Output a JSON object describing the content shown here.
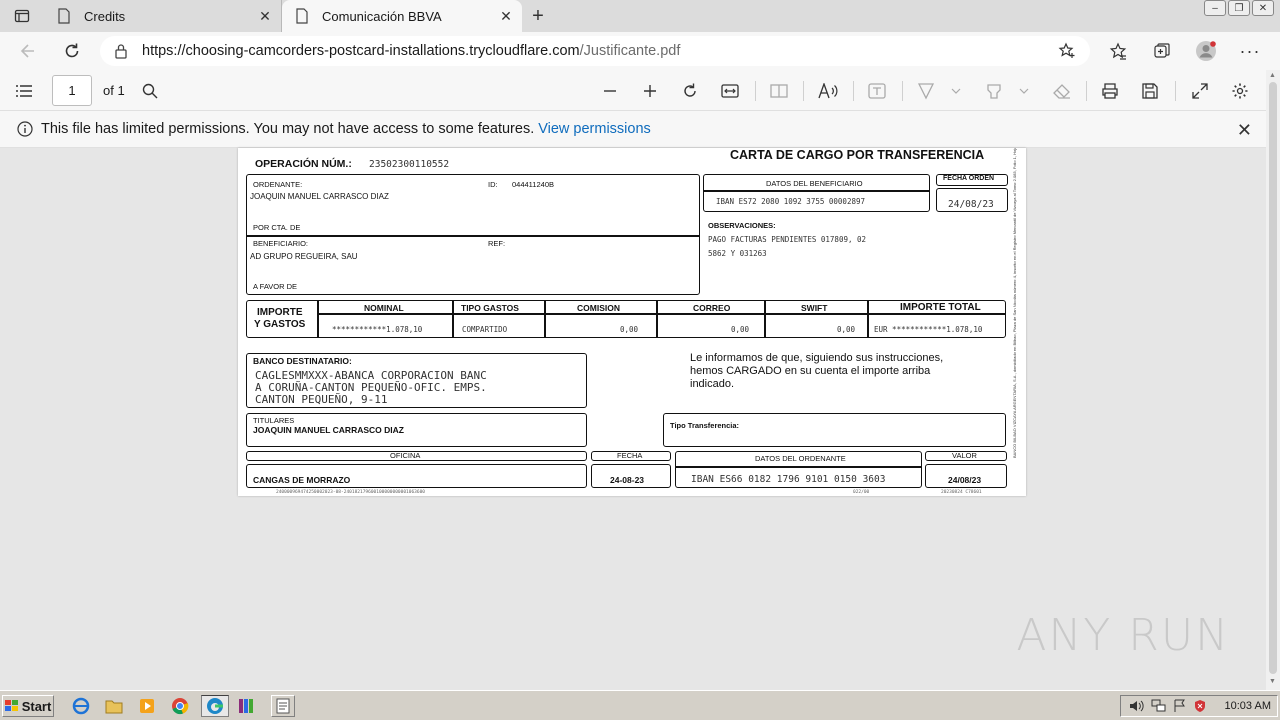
{
  "browser": {
    "tabs": [
      {
        "title": "Credits",
        "active": false
      },
      {
        "title": "Comunicación BBVA",
        "active": true
      }
    ],
    "url_domain": "https://choosing-camcorders-postcard-installations.trycloudflare.com",
    "url_path": "/Justificante.pdf"
  },
  "pdf_toolbar": {
    "page_value": "1",
    "page_total": "of 1"
  },
  "infobar": {
    "message": "This file has limited permissions. You may not have access to some features.",
    "link": "View permissions"
  },
  "doc": {
    "operacion_label": "OPERACIÓN  NÚM.:",
    "operacion_num": "23502300110552",
    "title": "CARTA DE CARGO POR TRANSFERENCIA",
    "ordenante_label": "ORDENANTE:",
    "ordenante_name": "JOAQUIN MANUEL CARRASCO DIAZ",
    "id_label": "ID:",
    "id_value": "044411240B",
    "por_cta_label": "POR CTA. DE",
    "beneficiario_label": "BENEFICIARIO:",
    "beneficiario_name": "AD GRUPO REGUEIRA, SAU",
    "ref_label": "REF:",
    "a_favor_label": "A FAVOR DE",
    "datos_benef_label": "DATOS DEL BENEFICIARIO",
    "benef_iban": "IBAN ES72 2080 1092 3755 00002897",
    "fecha_orden_label": "FECHA ORDEN",
    "fecha_orden_value": "24/08/23",
    "observaciones_label": "OBSERVACIONES:",
    "observaciones_line1": "PAGO FACTURAS PENDIENTES 017809, 02",
    "observaciones_line2": "5862 Y 031263",
    "importe_label_1": "IMPORTE",
    "importe_label_2": "Y GASTOS",
    "col_nominal": "NOMINAL",
    "col_tipo": "TIPO GASTOS",
    "col_comision": "COMISION",
    "col_correo": "CORREO",
    "col_swift": "SWIFT",
    "col_total": "IMPORTE TOTAL",
    "val_nominal": "************1.078,10",
    "val_tipo": "COMPARTIDO",
    "val_comision": "0,00",
    "val_correo": "0,00",
    "val_swift": "0,00",
    "val_total": "EUR ************1.078,10",
    "banco_dest_label": "BANCO DESTINATARIO:",
    "banco_line1": "CAGLESMMXXX-ABANCA CORPORACION BANC",
    "banco_line2": "A CORUÑA-CANTON PEQUEÑO-OFIC. EMPS.",
    "banco_line3": "CANTON PEQUEÑO, 9-11",
    "informamos_line1": "Le informamos de que, siguiendo sus instrucciones,",
    "informamos_line2": "hemos CARGADO en su cuenta el importe arriba",
    "informamos_line3": "indicado.",
    "titulares_label": "TITULARES",
    "titulares_name": "JOAQUIN MANUEL CARRASCO DIAZ",
    "tipo_transf_label": "Tipo Transferencia:",
    "oficina_label": "OFICINA",
    "oficina_value": "CANGAS DE MORRAZO",
    "fecha_label": "FECHA",
    "fecha_value": "24-08-23",
    "datos_ord_label": "DATOS DEL ORDENANTE",
    "ord_iban": "IBAN ES66 0182 1796 9101 0150 3603",
    "valor_label": "VALOR",
    "valor_value": "24/08/23",
    "footer_code": "240000969474250002023-08-240182179600100000000001063600",
    "footer_mid": "022/00",
    "footer_right": "20230824  C78601",
    "side_text": "BANCO BILBAO VIZCAYA ARGENTARIA, S.A., domiciliado en Bilbao, Plaza de San Nicolás número 4, inscrito en el Registro Mercantil de Vizcaya al Tomo 2.083, Folio 1, Hoja BI-17-A, Inscripción 1ª, CIF A 48265169"
  },
  "watermark": "ANY RUN",
  "taskbar": {
    "start_label": "Start",
    "clock": "10:03 AM"
  },
  "colors": {
    "link": "#0f6cbd",
    "edge_bg": "#f7f7f7",
    "content_bg": "#e6e6e6"
  }
}
